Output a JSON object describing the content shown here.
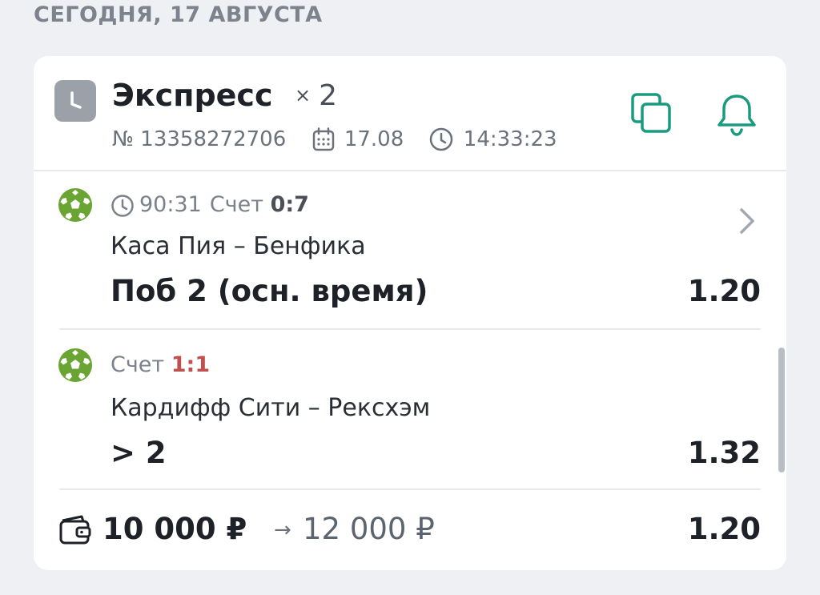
{
  "date_header": "СЕГОДНЯ, 17 АВГУСТА",
  "bet": {
    "type_label": "Экспресс",
    "multiplier_sign": "×",
    "multiplier_value": "2",
    "number": "№ 13358272706",
    "date": "17.08",
    "time": "14:33:23",
    "icons": {
      "status": "clock-icon",
      "copy": "copy-icon",
      "bell": "bell-icon"
    },
    "accent_color": "#1a9a7e"
  },
  "events": [
    {
      "sport_icon": "soccer-ball-icon",
      "match_time": "90:31",
      "score_label": "Счет",
      "score": "0:7",
      "teams": "Каса Пия – Бенфика",
      "outcome": "Поб 2 (осн. время)",
      "odds": "1.20"
    },
    {
      "sport_icon": "soccer-ball-icon",
      "score_label": "Счет",
      "score": "1:1",
      "score_color": "#c0504d",
      "teams": "Кардифф Сити – Рексхэм",
      "outcome": "> 2",
      "odds": "1.32"
    }
  ],
  "footer": {
    "stake": "10 000 ₽",
    "arrow": "→",
    "payout": "12 000 ₽",
    "total_odds": "1.20"
  }
}
